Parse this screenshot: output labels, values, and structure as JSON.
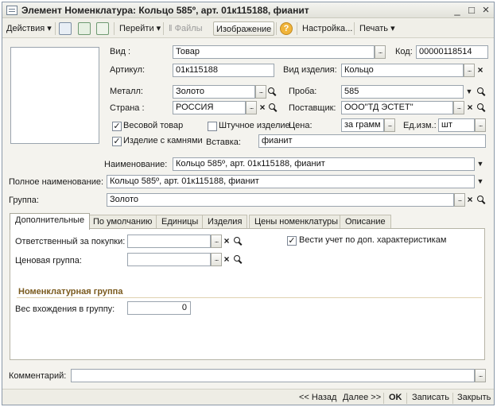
{
  "window": {
    "title": "Элемент Номенклатура: Кольцо  585º, арт. 01к115188, фианит",
    "minimize": "_",
    "maximize": "□",
    "close": "×"
  },
  "toolbar": {
    "actions": "Действия ▾",
    "goto": "Перейти ▾",
    "files": "Файлы",
    "image": "Изображение",
    "help": "?",
    "settings": "Настройка...",
    "print": "Печать ▾"
  },
  "form": {
    "vid_label": "Вид :",
    "vid_value": "Товар",
    "kod_label": "Код:",
    "kod_value": "00000118514",
    "artikul_label": "Артикул:",
    "artikul_value": "01к115188",
    "vid_izd_label": "Вид изделия:",
    "vid_izd_value": "Кольцо",
    "metall_label": "Металл:",
    "metall_value": "Золото",
    "proba_label": "Проба:",
    "proba_value": "585",
    "strana_label": "Страна :",
    "strana_value": "РОССИЯ",
    "postavshik_label": "Поставщик:",
    "postavshik_value": "ООО\"ТД ЭСТЕТ\"",
    "vesovoy_label": "Весовой товар",
    "shtuchnoe_label": "Штучное изделие",
    "cena_label": "Цена:",
    "cena_value": "за грамм",
    "ed_izm_label": "Ед.изм.:",
    "ed_izm_value": "шт",
    "kamni_label": "Изделие с камнями",
    "vstavka_label": "Вставка:",
    "vstavka_value": "фианит",
    "naimenovanie_label": "Наименование:",
    "naimenovanie_value": "Кольцо  585º, арт. 01к115188, фианит",
    "polnoe_label": "Полное наименование:",
    "polnoe_value": "Кольцо  585º, арт. 01к115188, фианит",
    "gruppa_label": "Группа:",
    "gruppa_value": "Золото",
    "checked_mark": "✓"
  },
  "tabs": [
    {
      "label": "Дополнительные"
    },
    {
      "label": "По умолчанию"
    },
    {
      "label": "Единицы"
    },
    {
      "label": "Изделия"
    },
    {
      "label": "Цены номенклатуры"
    },
    {
      "label": "Описание"
    }
  ],
  "tab_panel": {
    "otvetstvenny_label": "Ответственный за покупки:",
    "otvetstvenny_value": "",
    "cenovaya_label": "Ценовая группа:",
    "cenovaya_value": "",
    "vesti_uchet_label": "Вести учет по доп. характеристикам",
    "section_title": "Номенклатурная группа",
    "ves_label": "Вес вхождения в группу:",
    "ves_value": "0"
  },
  "comment": {
    "label": "Комментарий:",
    "value": ""
  },
  "bottom": {
    "back": "<< Назад",
    "next": "Далее >>",
    "ok": "OK",
    "save": "Записать",
    "close": "Закрыть"
  },
  "colors": {
    "section_title": "#7a5a1e",
    "window_bg": "#f4f3ee"
  }
}
